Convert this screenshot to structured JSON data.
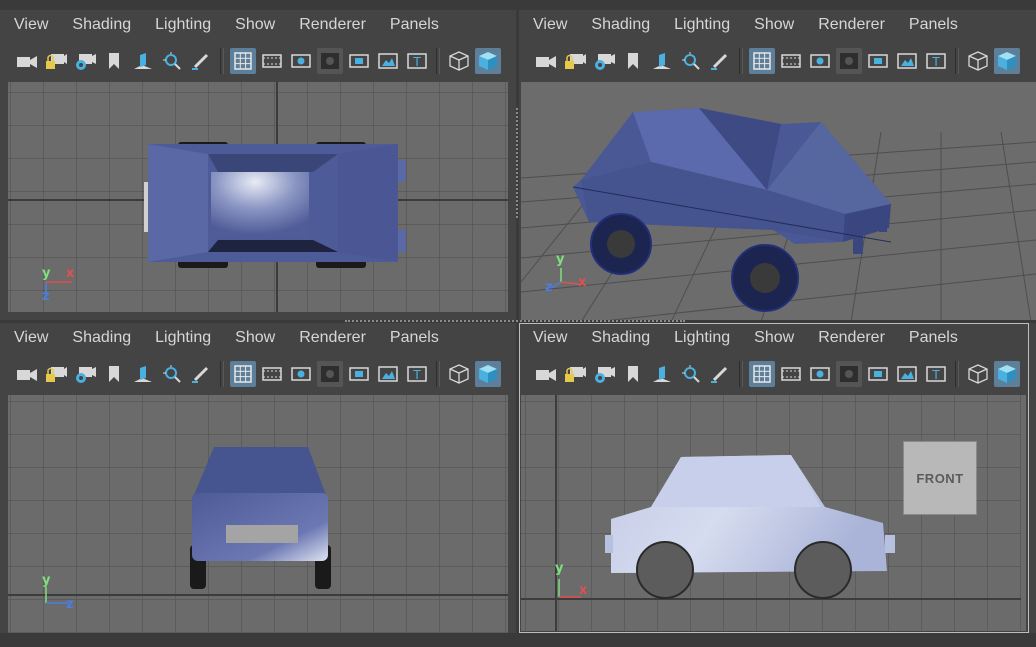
{
  "menus": [
    "View",
    "Shading",
    "Lighting",
    "Show",
    "Renderer",
    "Panels"
  ],
  "toolbar_icons": [
    "camera-icon",
    "camera-lock-icon",
    "camera-attributes-icon",
    "bookmark-icon",
    "image-plane-icon",
    "zoom-2d-icon",
    "grease-pencil-icon",
    "grid-icon",
    "film-gate-icon",
    "resolution-gate-icon",
    "gate-mask-icon",
    "field-chart-icon",
    "safe-action-icon",
    "safe-title-icon",
    "wireframe-cube-icon",
    "shaded-cube-icon"
  ],
  "viewports": [
    {
      "name": "top-view",
      "axes": {
        "v": "y",
        "h": "x",
        "d": "z"
      }
    },
    {
      "name": "perspective-view",
      "axes": {
        "v": "y",
        "h": "x",
        "d": "z"
      }
    },
    {
      "name": "side-view",
      "axes": {
        "v": "y",
        "h": "z"
      }
    },
    {
      "name": "front-view",
      "axes": {
        "v": "y",
        "h": "x"
      },
      "cube_label": "FRONT"
    }
  ],
  "colors": {
    "car_blue": "#4a5a96",
    "grid_bg": "#6b6b6b",
    "accent": "#5e7f99"
  }
}
